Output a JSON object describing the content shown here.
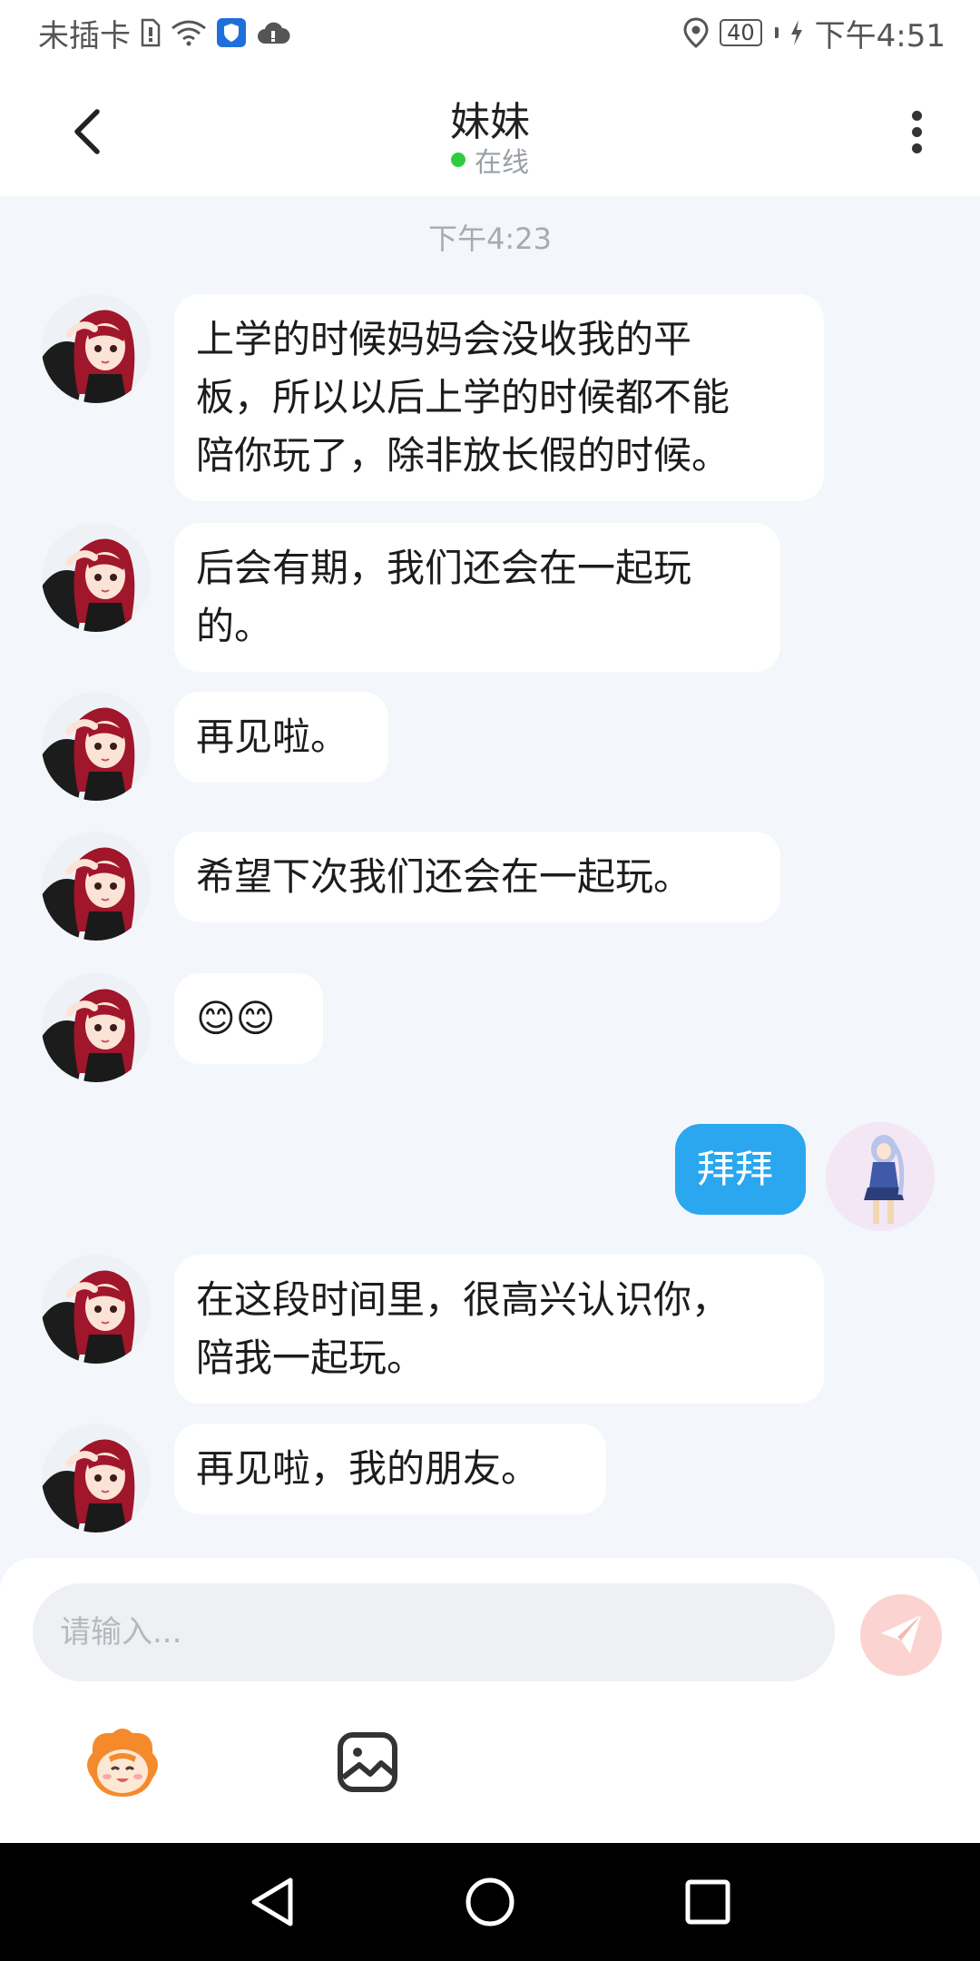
{
  "status_bar": {
    "carrier": "未插卡",
    "battery": "40",
    "time": "下午4:51",
    "icons": [
      "sim-icon",
      "wifi-icon",
      "shield-icon",
      "cloud-icon",
      "location-icon",
      "battery-icon",
      "charging-icon"
    ]
  },
  "header": {
    "title": "妹妹",
    "status": "在线",
    "online_color": "#2ecc40"
  },
  "chat": {
    "timestamp": "下午4:23",
    "messages": [
      {
        "sender": "contact",
        "lines": [
          "上学的时候妈妈会没收我的平",
          "板，所以以后上学的时候都不能",
          "陪你玩了，除非放长假的时候。"
        ]
      },
      {
        "sender": "contact",
        "lines": [
          "后会有期，我们还会在一起玩",
          "的。"
        ]
      },
      {
        "sender": "contact",
        "lines": [
          "再见啦。"
        ]
      },
      {
        "sender": "contact",
        "lines": [
          "希望下次我们还会在一起玩。"
        ]
      },
      {
        "sender": "contact",
        "lines": [
          "😊😊"
        ]
      },
      {
        "sender": "me",
        "lines": [
          "拜拜"
        ]
      },
      {
        "sender": "contact",
        "lines": [
          "在这段时间里，很高兴认识你，",
          "陪我一起玩。"
        ]
      },
      {
        "sender": "contact",
        "lines": [
          "再见啦，我的朋友。"
        ]
      }
    ]
  },
  "input": {
    "placeholder": "请输入..."
  },
  "colors": {
    "accent": "#2aa7ee",
    "send_button": "#fbd4d1",
    "background": "#f3f6fa"
  },
  "toolbar": {
    "icons": [
      "mascot-emoji-icon",
      "image-picker-icon"
    ]
  },
  "nav": {
    "icons": [
      "back-triangle-icon",
      "home-circle-icon",
      "recents-square-icon"
    ]
  }
}
